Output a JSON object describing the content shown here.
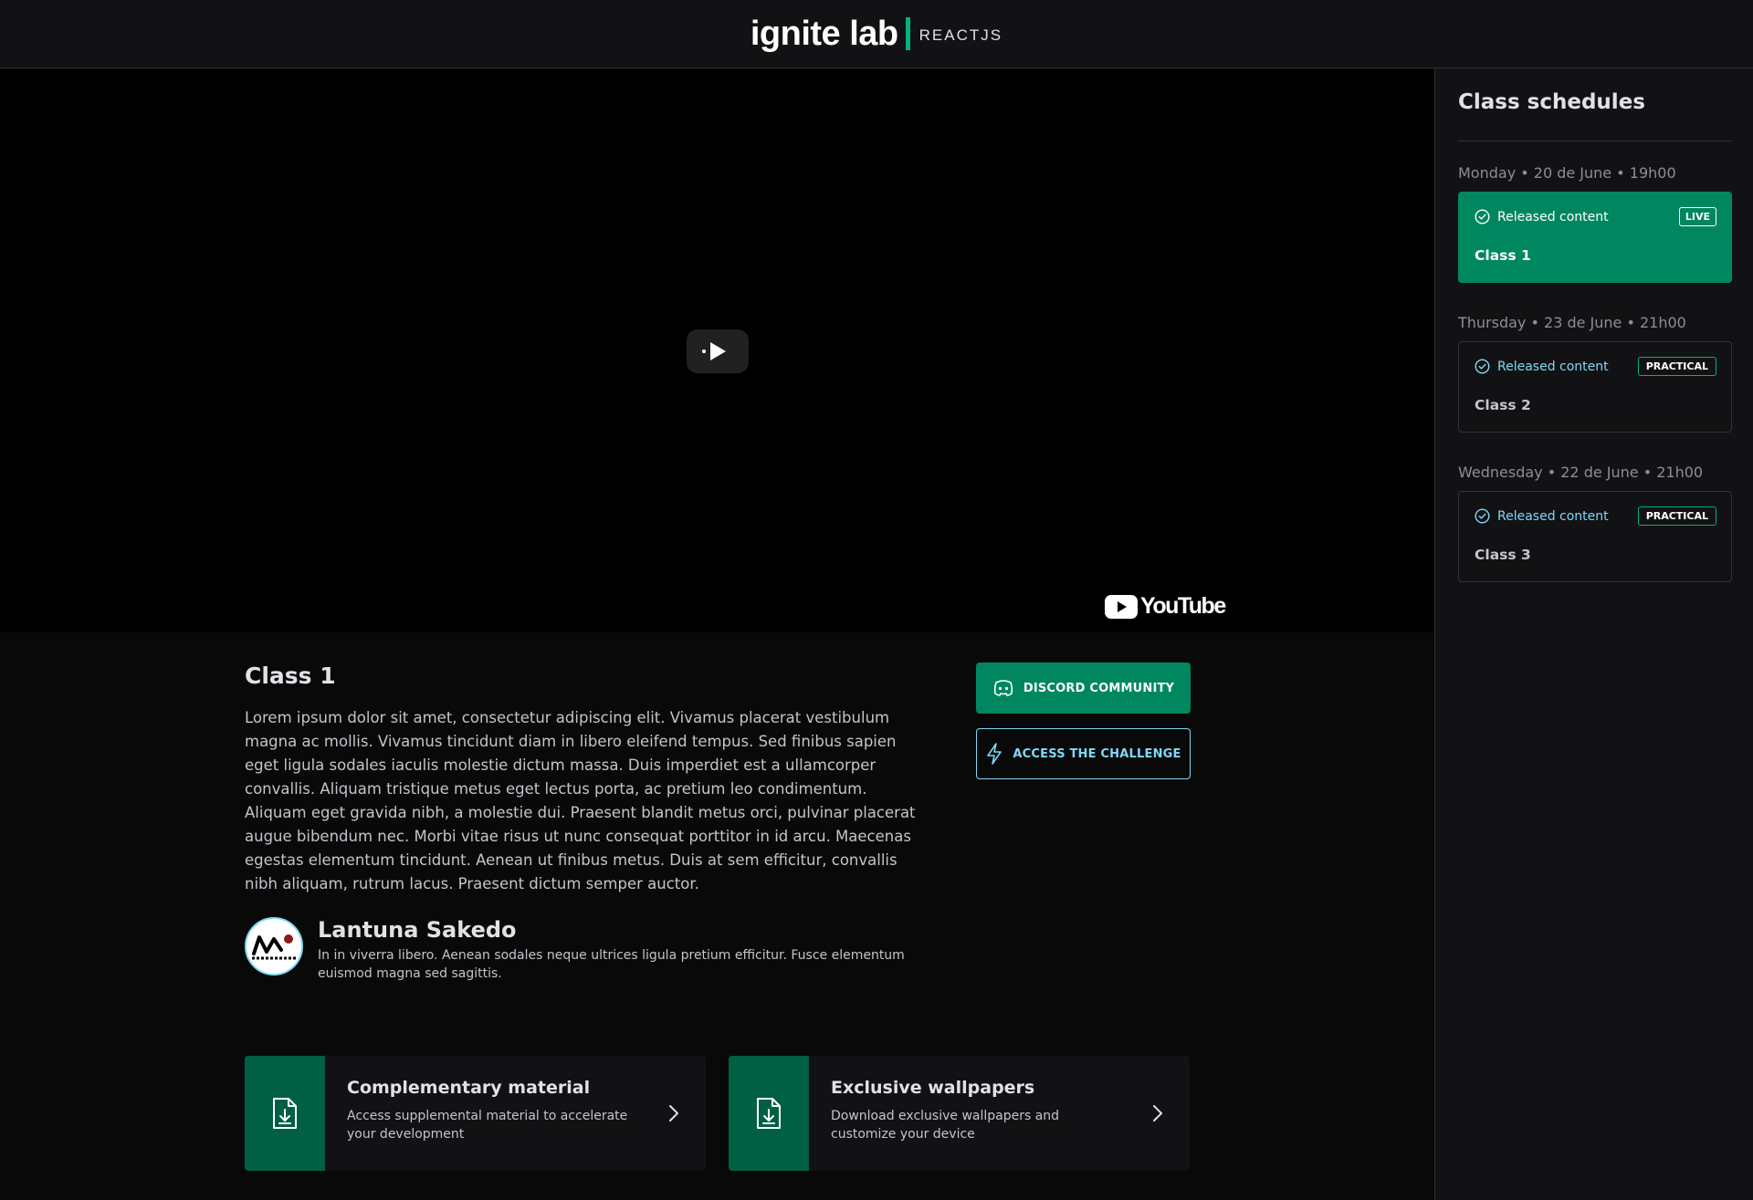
{
  "header": {
    "logo_main": "ignite lab",
    "logo_sub": "REACTJS"
  },
  "video": {
    "player_brand": "YouTube"
  },
  "lesson": {
    "title": "Class 1",
    "description": "Lorem ipsum dolor sit amet, consectetur adipiscing elit. Vivamus placerat vestibulum magna ac mollis. Vivamus tincidunt diam in libero eleifend tempus. Sed finibus sapien eget ligula sodales iaculis molestie dictum massa. Duis imperdiet est a ullamcorper convallis. Aliquam tristique metus eget lectus porta, ac pretium leo condimentum. Aliquam eget gravida nibh, a molestie dui. Praesent blandit metus orci, pulvinar placerat augue bibendum nec. Morbi vitae risus ut nunc consequat porttitor in id arcu. Maecenas egestas elementum tincidunt. Aenean ut finibus metus. Duis at sem efficitur, convallis nibh aliquam, rutrum lacus. Praesent dictum semper auctor.",
    "teacher": {
      "name": "Lantuna Sakedo",
      "bio": "In in viverra libero. Aenean sodales neque ultrices ligula pretium efficitur. Fusce elementum euismod magna sed sagittis."
    },
    "buttons": {
      "discord": "DISCORD COMMUNITY",
      "challenge": "ACCESS THE CHALLENGE"
    }
  },
  "cards": [
    {
      "title": "Complementary material",
      "description": "Access supplemental material to accelerate your development",
      "icon": "file-download-icon"
    },
    {
      "title": "Exclusive wallpapers",
      "description": "Download exclusive wallpapers and customize your device",
      "icon": "file-download-icon"
    }
  ],
  "sidebar": {
    "title": "Class schedules",
    "lessons": [
      {
        "date": "Monday • 20 de June • 19h00",
        "status": "Released content",
        "badge": "LIVE",
        "name": "Class 1",
        "active": true
      },
      {
        "date": "Thursday • 23 de June • 21h00",
        "status": "Released content",
        "badge": "PRACTICAL",
        "name": "Class 2",
        "active": false
      },
      {
        "date": "Wednesday • 22 de June • 21h00",
        "status": "Released content",
        "badge": "PRACTICAL",
        "name": "Class 3",
        "active": false
      }
    ]
  },
  "colors": {
    "background": "#09090a",
    "panel": "#121214",
    "brand_green": "#00875f",
    "brand_green_dark": "#015f43",
    "accent_blue": "#81d8f7",
    "border": "#323238"
  }
}
